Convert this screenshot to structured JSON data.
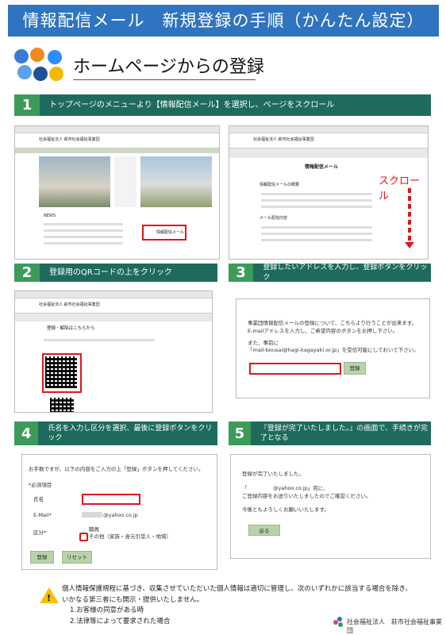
{
  "header": {
    "title": "情報配信メール　新規登録の手順（かんたん設定）"
  },
  "section": {
    "title": "ホームページからの登録"
  },
  "steps": [
    {
      "num": "1",
      "text": "トップページのメニューより【情報配信メール】を選択し、ページをスクロール"
    },
    {
      "num": "2",
      "text": "登録用のQRコードの上をクリック"
    },
    {
      "num": "3",
      "text": "登録したいアドレスを入力し、登録ボタンをクリック"
    },
    {
      "num": "4",
      "text": "氏名を入力し区分を選択、最後に登録ボタンをクリック"
    },
    {
      "num": "5",
      "text": "『登録が完了いたしました。』の画面で、手続きが完了となる"
    }
  ],
  "screens": {
    "s1_org": "社会福祉法人 萩市社会福祉事業団",
    "s1_news": "NEWS",
    "s1_mail_link": "情報配信メール",
    "s2_org": "社会福祉法人 萩市社会福祉事業団",
    "s2_heading": "情報配信メール",
    "s2_sub1": "情報配信メールの概要",
    "s2_sub2": "メール配信内容",
    "s2_scroll": "スクロール",
    "s3_org": "社会福祉法人 萩市社会福祉事業団",
    "s3_heading": "登録・解除はこちらから",
    "s4_line1": "事業団情報配信メールの登録について、こちらより行うことが出来ます。",
    "s4_line2": "E-mailアドレスを入力し、ご希望内容のボタンをお押し下さい。",
    "s4_line3": "また、事前に",
    "s4_line4": "「mail-bousai@hagi-kagayaki.or.jp」を受信可能にしておいて下さい。",
    "s4_button": "登録",
    "s5_intro": "お手数ですが、以下の内容をご入力の上「登録」ボタンを押してください。",
    "s5_required": "*必須項目",
    "s5_name_label": "氏名",
    "s5_email_label": "E-Mail*",
    "s5_email_value": "@yahoo.co.jp",
    "s5_cat_label": "区分*",
    "s5_opt1": "職員",
    "s5_opt2": "その他（家族・身元引受人・地域）",
    "s5_submit": "登録",
    "s5_reset": "リセット",
    "s6_line1": "登録が完了いたしました。",
    "s6_line2": "「　　　　　@yahoo.co.jp」宛に、",
    "s6_line3": "ご登録内容をお送りいたしましたのでご確認ください。",
    "s6_line4": "今後ともよろしくお願いいたします。",
    "s6_back": "戻る"
  },
  "notice": {
    "line1": "個人情報保護規程に基づき、収集させていただいた個人情報は適切に管理し、次のいずれかに該当する場合を除き、",
    "line2": "いかなる第三者にも開示・提供いたしません。",
    "line3": "1.お客様の同意がある時",
    "line4": "2.法律等によって要求された場合"
  },
  "footer": {
    "org": "社会福祉法人　萩市社会福祉事業団"
  },
  "colors": {
    "title_bg": "#2f74c0",
    "step_bg": "#1e6b5e",
    "step_num": "#3d9b5a",
    "highlight": "#e0161b"
  }
}
